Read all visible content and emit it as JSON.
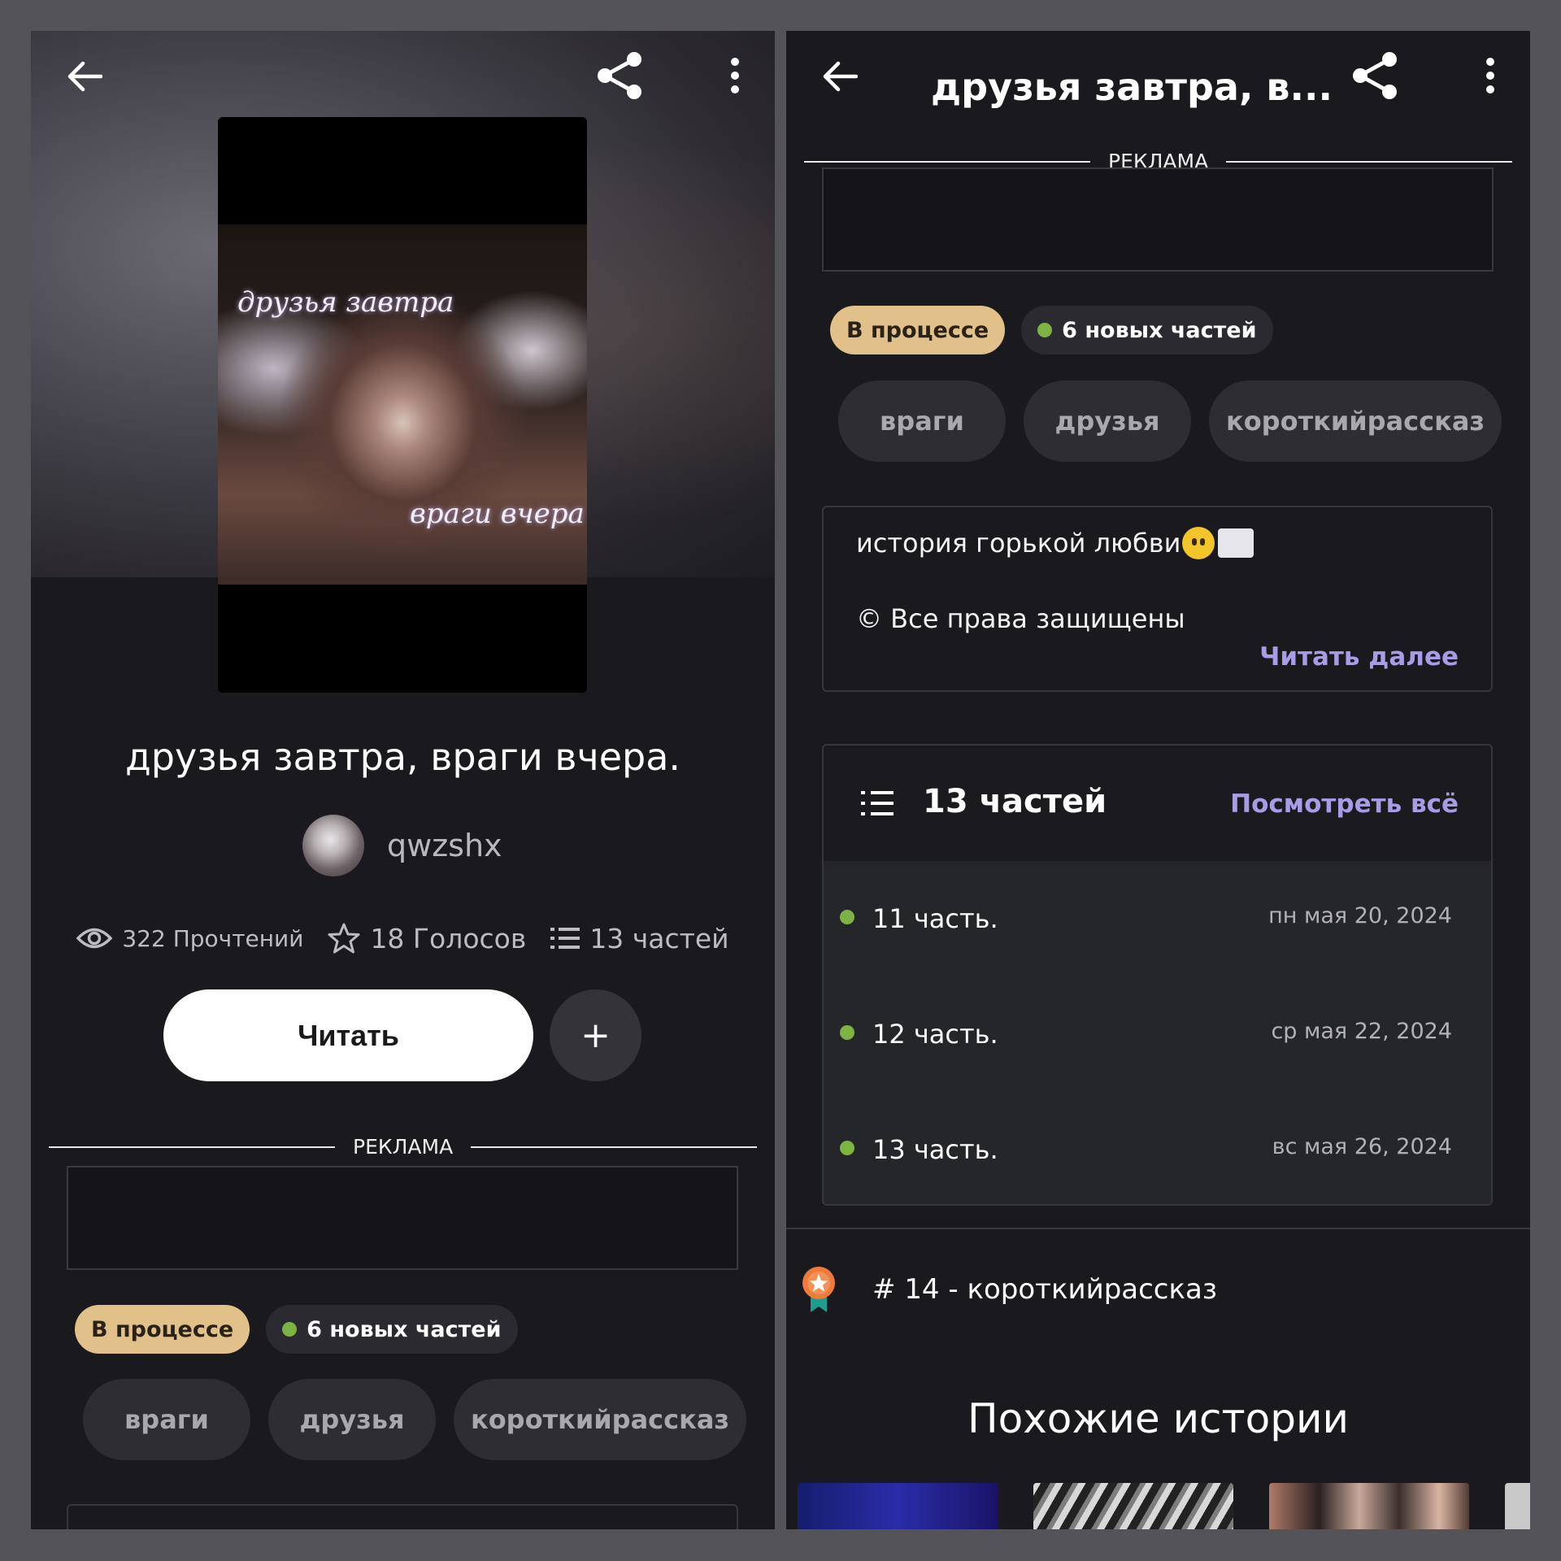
{
  "left": {
    "title": "друзья завтра, враги вчера.",
    "cover_text_top": "друзья завтра",
    "cover_text_bottom": "враги вчера",
    "author": "qwzshx",
    "stats": {
      "reads": "322 Прочтений",
      "votes": "18 Голосов",
      "parts": "13 частей"
    },
    "read_button": "Читать",
    "add_button": "+",
    "ad_label": "РЕКЛАМА",
    "status": "В процессе",
    "new_parts": "6 новых частей",
    "tags": [
      "враги",
      "друзья",
      "короткийрассказ"
    ]
  },
  "right": {
    "header_title": "друзья завтра, в...",
    "ad_label": "РЕКЛАМА",
    "status": "В процессе",
    "new_parts": "6 новых частей",
    "tags": [
      "враги",
      "друзья",
      "короткийрассказ"
    ],
    "description": {
      "line1": "история горькой любви",
      "line2": "© Все права защищены",
      "read_more": "Читать далее"
    },
    "parts": {
      "title": "13 частей",
      "see_all": "Посмотреть всё",
      "items": [
        {
          "name": "11 часть.",
          "date": "пн мая 20, 2024"
        },
        {
          "name": "12 часть.",
          "date": "ср мая 22, 2024"
        },
        {
          "name": "13 часть.",
          "date": "вс мая 26, 2024"
        }
      ]
    },
    "rank": "# 14 - короткийрассказ",
    "similar_title": "Похожие истории"
  },
  "icons": {
    "back": "back-arrow-icon",
    "share": "share-icon",
    "more": "more-vertical-icon",
    "eye": "eye-icon",
    "star": "star-icon",
    "list": "list-icon",
    "medal": "rank-medal-icon"
  },
  "colors": {
    "background": "#1a191e",
    "status_chip": "#e2c08a",
    "accent_link": "#a89ce6",
    "new_dot": "#7cb342"
  }
}
